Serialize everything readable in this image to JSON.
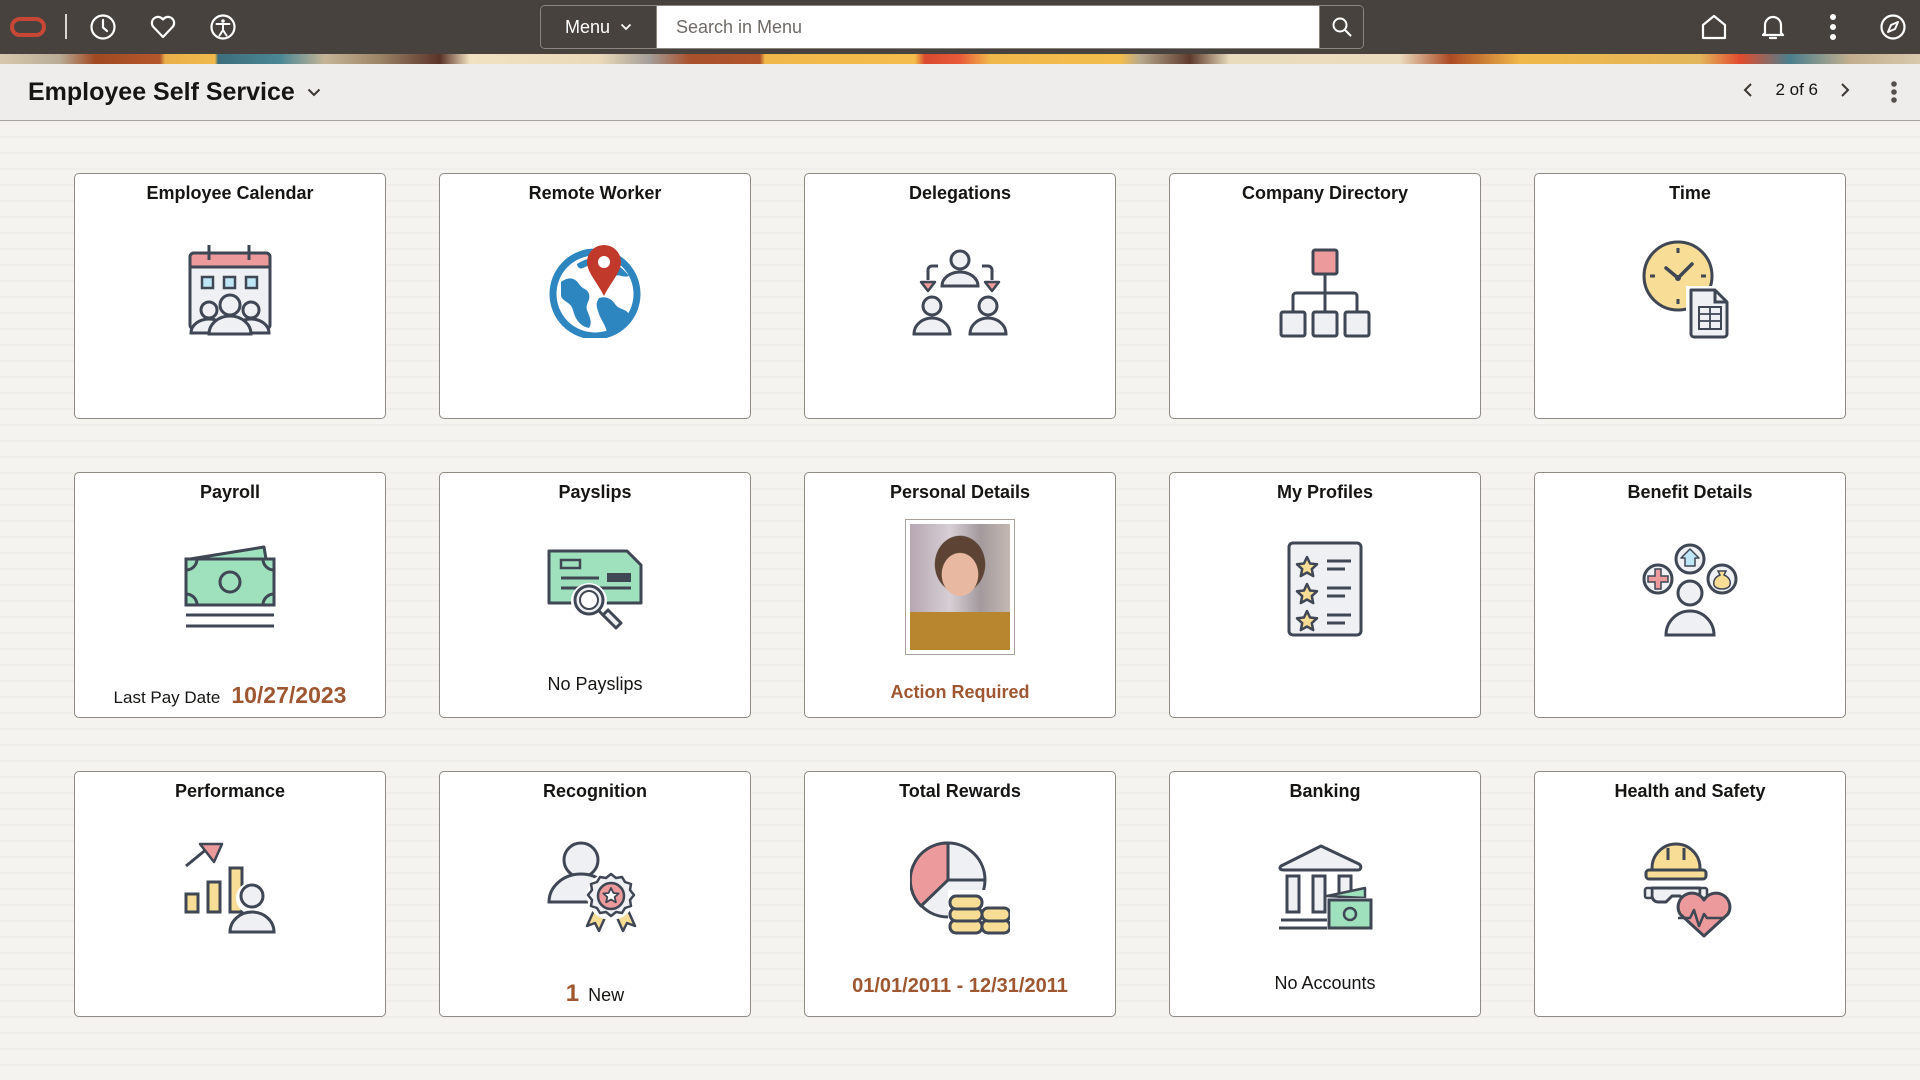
{
  "header": {
    "icons": {
      "logo": "oracle-logo-icon",
      "recent": "clock-icon",
      "favorites": "heart-icon",
      "accessibility": "accessibility-icon",
      "home": "home-icon",
      "notifications": "bell-icon",
      "actions": "kebab-menu-icon",
      "navigator": "compass-icon"
    },
    "menu_label": "Menu",
    "search": {
      "placeholder": "Search in Menu",
      "value": ""
    }
  },
  "titlebar": {
    "title": "Employee Self Service",
    "pager": "2 of 6"
  },
  "colors": {
    "header_bg": "#47423d",
    "accent_text": "#9e5731",
    "tile_border": "#8f8a84"
  },
  "tiles": [
    {
      "title": "Employee Calendar",
      "icon": "calendar-people-icon"
    },
    {
      "title": "Remote Worker",
      "icon": "globe-location-icon"
    },
    {
      "title": "Delegations",
      "icon": "delegation-icon"
    },
    {
      "title": "Company Directory",
      "icon": "org-chart-icon"
    },
    {
      "title": "Time",
      "icon": "clock-timesheet-icon"
    },
    {
      "title": "Payroll",
      "icon": "money-icon",
      "footer_label": "Last Pay Date",
      "footer_value": "10/27/2023"
    },
    {
      "title": "Payslips",
      "icon": "payslip-search-icon",
      "footer_label": "No Payslips"
    },
    {
      "title": "Personal Details",
      "icon": "profile-photo",
      "footer_value": "Action Required"
    },
    {
      "title": "My Profiles",
      "icon": "star-list-icon"
    },
    {
      "title": "Benefit Details",
      "icon": "benefits-person-icon"
    },
    {
      "title": "Performance",
      "icon": "performance-chart-icon"
    },
    {
      "title": "Recognition",
      "icon": "award-person-icon",
      "footer_value": "1",
      "footer_label": "New"
    },
    {
      "title": "Total Rewards",
      "icon": "pie-coins-icon",
      "footer_value": "01/01/2011 - 12/31/2011"
    },
    {
      "title": "Banking",
      "icon": "bank-money-icon",
      "footer_label": "No Accounts"
    },
    {
      "title": "Health and Safety",
      "icon": "hardhat-heart-icon"
    }
  ]
}
